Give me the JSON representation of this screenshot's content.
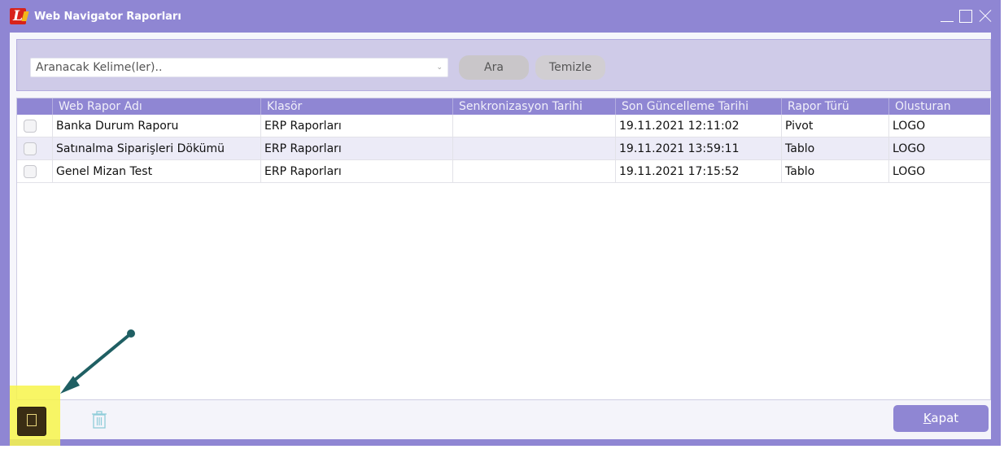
{
  "window": {
    "title": "Web Navigator Raporları",
    "logo_letter": "L"
  },
  "search": {
    "placeholder": "Aranacak Kelime(ler)..",
    "ara_label": "Ara",
    "temizle_label": "Temizle"
  },
  "grid": {
    "columns": [
      "",
      "Web Rapor Adı",
      "Klasör",
      "Senkronizasyon Tarihi",
      "Son Güncelleme Tarihi",
      "Rapor Türü",
      "Olusturan"
    ],
    "rows": [
      {
        "name": "Banka Durum Raporu",
        "folder": "ERP Raporları",
        "sync_date": "",
        "updated": "19.11.2021 12:11:02",
        "type": "Pivot",
        "creator": "LOGO"
      },
      {
        "name": "Satınalma Siparişleri Dökümü",
        "folder": "ERP Raporları",
        "sync_date": "",
        "updated": "19.11.2021 13:59:11",
        "type": "Tablo",
        "creator": "LOGO"
      },
      {
        "name": "Genel Mizan Test",
        "folder": "ERP Raporları",
        "sync_date": "",
        "updated": "19.11.2021 17:15:52",
        "type": "Tablo",
        "creator": "LOGO"
      }
    ]
  },
  "footer": {
    "kapat_label_first": "K",
    "kapat_label_rest": "apat"
  },
  "icons": {
    "new": "new-document-icon",
    "delete": "trash-icon"
  },
  "colors": {
    "accent": "#8f86d3",
    "highlight": "#f7f44a",
    "annotation_arrow": "#1f5f63"
  }
}
